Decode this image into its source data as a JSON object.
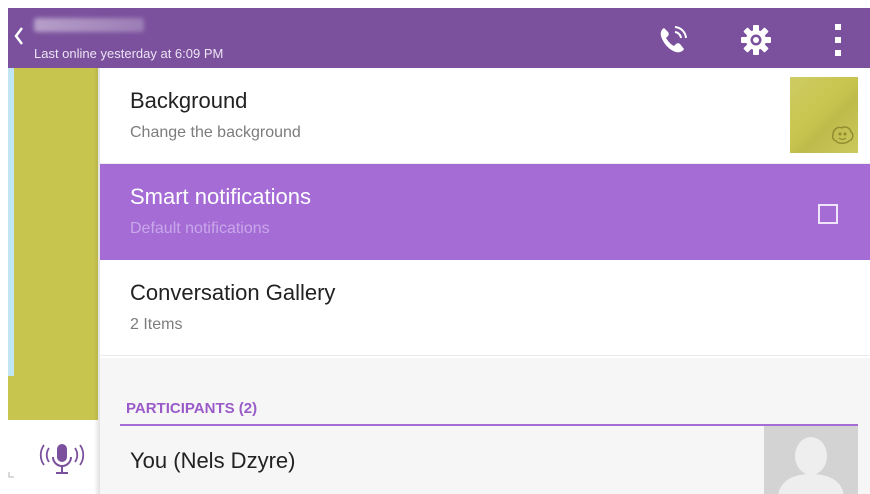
{
  "header": {
    "subtitle": "Last online yesterday at 6:09 PM",
    "icons": [
      "back-icon",
      "call-icon",
      "settings-icon",
      "overflow-menu-icon"
    ],
    "color": "#7b519d"
  },
  "chat": {
    "wallpaper_color": "#c8c54f",
    "icons": [
      "microphone-icon"
    ]
  },
  "settings": {
    "background": {
      "title": "Background",
      "subtitle": "Change the background"
    },
    "smart_notifications": {
      "title": "Smart notifications",
      "subtitle": "Default notifications",
      "checked": false,
      "highlight_color": "#a56cd6"
    },
    "gallery": {
      "title": "Conversation Gallery",
      "subtitle": "2 Items"
    }
  },
  "participants": {
    "header": "PARTICIPANTS (2)",
    "list": [
      {
        "name": "You (Nels Dzyre)"
      }
    ]
  }
}
